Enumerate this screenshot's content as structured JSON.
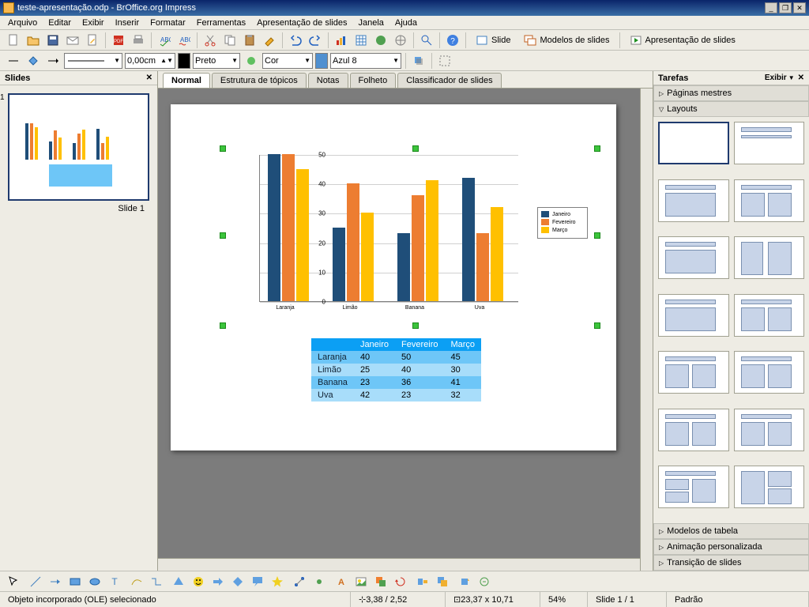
{
  "title": "teste-apresentação.odp - BrOffice.org Impress",
  "menus": [
    "Arquivo",
    "Editar",
    "Exibir",
    "Inserir",
    "Formatar",
    "Ferramentas",
    "Apresentação de slides",
    "Janela",
    "Ajuda"
  ],
  "toolbar2": {
    "linewidth": "0,00cm",
    "color1": "Preto",
    "color2": "Cor",
    "color3": "Azul 8"
  },
  "labeled_buttons": {
    "slide": "Slide",
    "models": "Modelos de slides",
    "present": "Apresentação de slides"
  },
  "slides_panel": {
    "title": "Slides",
    "slide_label": "Slide 1",
    "slide_number": "1"
  },
  "view_tabs": [
    "Normal",
    "Estrutura de tópicos",
    "Notas",
    "Folheto",
    "Classificador de slides"
  ],
  "tasks_panel": {
    "title": "Tarefas",
    "view_label": "Exibir",
    "sections": {
      "masters": "Páginas mestres",
      "layouts": "Layouts",
      "table_models": "Modelos de tabela",
      "custom_anim": "Animação personalizada",
      "transition": "Transição de slides"
    }
  },
  "status": {
    "selection": "Objeto incorporado (OLE) selecionado",
    "pos": "3,38 / 2,52",
    "size": "23,37 x 10,71",
    "zoom": "54%",
    "page": "Slide 1 / 1",
    "style": "Padrão"
  },
  "chart_data": {
    "type": "bar",
    "categories": [
      "Laranja",
      "Limão",
      "Banana",
      "Uva"
    ],
    "series": [
      {
        "name": "Janeiro",
        "values": [
          50,
          25,
          23,
          42
        ]
      },
      {
        "name": "Fevereiro",
        "values": [
          50,
          40,
          36,
          23
        ]
      },
      {
        "name": "Março",
        "values": [
          45,
          30,
          41,
          32
        ]
      }
    ],
    "ylim": [
      0,
      50
    ],
    "yticks": [
      0,
      10,
      20,
      30,
      40,
      50
    ]
  },
  "table": {
    "headers": [
      "",
      "Janeiro",
      "Fevereiro",
      "Março"
    ],
    "rows": [
      [
        "Laranja",
        "40",
        "50",
        "45"
      ],
      [
        "Limão",
        "25",
        "40",
        "30"
      ],
      [
        "Banana",
        "23",
        "36",
        "41"
      ],
      [
        "Uva",
        "42",
        "23",
        "32"
      ]
    ]
  }
}
